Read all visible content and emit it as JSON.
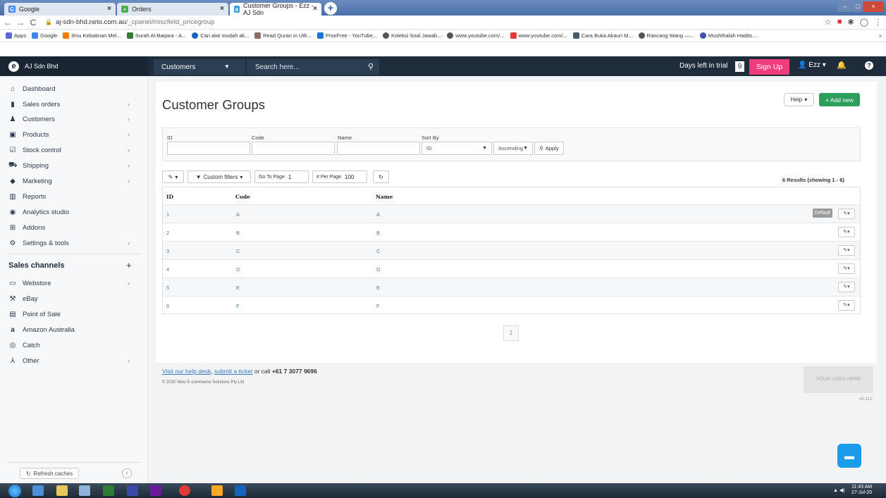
{
  "browser": {
    "tabs": [
      {
        "label": "Google"
      },
      {
        "label": "Orders"
      },
      {
        "label": "Customer Groups - Ezz - AJ Sdn"
      }
    ],
    "new_tab_glyph": "+",
    "url_domain": "aj-sdn-bhd.neto.com.au",
    "url_path": "/_cpanel/miscfield_pricegroup",
    "bookmarks": [
      "Apps",
      "Google",
      "Ilmu Kebatinan Mel...",
      "Surah Al-Baqara - A...",
      "Cari alat mudah ali...",
      "Read Quran in Uth...",
      "ProxFree - YouTube...",
      "Koleksi Soal Jawab...",
      "www.youtube.com/...",
      "www.youtube.com/...",
      "Cara Buka Akaun M...",
      "Rancang Wang —...",
      "Mushthalah Hadits..."
    ],
    "bookmarks_more": "»"
  },
  "header": {
    "brand": "AJ Sdn Bhd",
    "search_scope": "Customers",
    "search_placeholder": "Search here...",
    "trial_label": "Days left in trial",
    "trial_days": "9",
    "signup_label": "Sign Up",
    "user_label": "Ezz"
  },
  "sidebar": {
    "items": [
      {
        "label": "Dashboard",
        "icon": "home-icon"
      },
      {
        "label": "Sales orders",
        "icon": "file-icon"
      },
      {
        "label": "Customers",
        "icon": "users-icon"
      },
      {
        "label": "Products",
        "icon": "box-icon"
      },
      {
        "label": "Stock control",
        "icon": "check-box-icon"
      },
      {
        "label": "Shipping",
        "icon": "truck-icon"
      },
      {
        "label": "Marketing",
        "icon": "tag-icon"
      },
      {
        "label": "Reports",
        "icon": "bar-chart-icon"
      },
      {
        "label": "Analytics studio",
        "icon": "analytics-icon"
      },
      {
        "label": "Addons",
        "icon": "plus-square-icon"
      },
      {
        "label": "Settings & tools",
        "icon": "gear-icon"
      }
    ],
    "channels_heading": "Sales channels",
    "channels": [
      {
        "label": "Webstore",
        "icon": "webstore-icon"
      },
      {
        "label": "eBay",
        "icon": "gavel-icon"
      },
      {
        "label": "Point of Sale",
        "icon": "store-icon"
      },
      {
        "label": "Amazon Australia",
        "icon": "amazon-icon"
      },
      {
        "label": "Catch",
        "icon": "catch-icon"
      },
      {
        "label": "Other",
        "icon": "sitemap-icon"
      }
    ],
    "refresh_label": "Refresh caches"
  },
  "page": {
    "title": "Customer Groups",
    "help_label": "Help",
    "add_new_label": "+ Add new"
  },
  "filters": {
    "id_label": "ID",
    "code_label": "Code",
    "name_label": "Name",
    "sort_by_label": "Sort By",
    "sort_by_value": "ID",
    "order_value": "Ascending",
    "apply_label": "Apply"
  },
  "toolbar": {
    "custom_filters_label": "Custom filters",
    "go_to_page_label": "Go To Page",
    "go_to_page_value": "1",
    "per_page_label": "# Per Page",
    "per_page_value": "100",
    "results_text": "6 Results (showing 1 - 6)"
  },
  "table": {
    "columns": [
      "ID",
      "Code",
      "Name"
    ],
    "rows": [
      {
        "id": "1",
        "code": "A",
        "name": "A",
        "badge": "Default"
      },
      {
        "id": "2",
        "code": "B",
        "name": "B"
      },
      {
        "id": "3",
        "code": "C",
        "name": "C"
      },
      {
        "id": "4",
        "code": "D",
        "name": "D"
      },
      {
        "id": "5",
        "code": "E",
        "name": "E"
      },
      {
        "id": "6",
        "code": "F",
        "name": "F"
      }
    ]
  },
  "pagination": {
    "current": "1"
  },
  "footer": {
    "help_desk_link": "Visit our help desk",
    "ticket_link": "submit a ticket",
    "call_text": "or call",
    "phone": "+61 7 3077 9696",
    "copyright": "© 2020 Neto E-commerce Solutions Pty Ltd",
    "logo_placeholder": "YOUR LOGO HERE",
    "version": "v6.112"
  },
  "taskbar": {
    "time": "11:43 AM",
    "date": "27-Jul-20"
  },
  "colors": {
    "header_bg": "#1f2c3c",
    "signup": "#ef3c7d",
    "add_new": "#2d9f5c",
    "link": "#4a7fb8"
  }
}
